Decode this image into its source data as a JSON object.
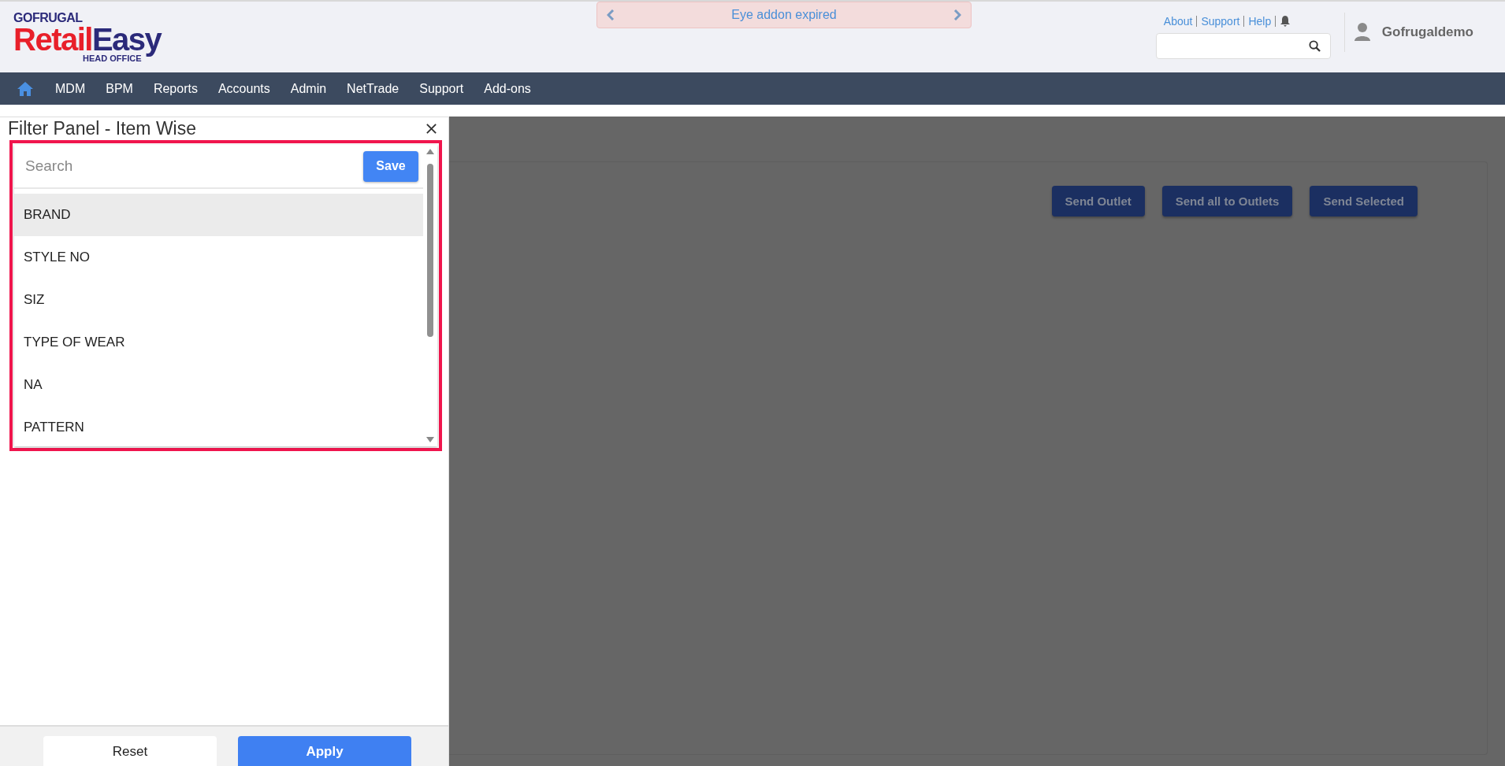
{
  "logo": {
    "company": "GOFRUGAL",
    "product_first": "Retail",
    "product_second": "Easy",
    "edition": "HEAD OFFICE"
  },
  "notice": {
    "text": "Eye addon expired"
  },
  "top_links": [
    "About",
    "Support",
    "Help"
  ],
  "user": {
    "name": "Gofrugaldemo"
  },
  "nav": [
    "MDM",
    "BPM",
    "Reports",
    "Accounts",
    "Admin",
    "NetTrade",
    "Support",
    "Add-ons"
  ],
  "filter_panel": {
    "title": "Filter Panel - Item Wise",
    "search": {
      "placeholder": "Search"
    },
    "save": "Save",
    "items": [
      {
        "label": "BRAND",
        "selected": true
      },
      {
        "label": "STYLE NO",
        "selected": false
      },
      {
        "label": "SIZ",
        "selected": false
      },
      {
        "label": "TYPE OF WEAR",
        "selected": false
      },
      {
        "label": "NA",
        "selected": false
      },
      {
        "label": "PATTERN",
        "selected": false
      }
    ],
    "buttons": [
      {
        "label": "Reset",
        "kind": "secondary"
      },
      {
        "label": "Apply",
        "kind": "primary"
      }
    ]
  },
  "page_buttons": [
    "Send Outlet",
    "Send all to Outlets",
    "Send Selected"
  ]
}
